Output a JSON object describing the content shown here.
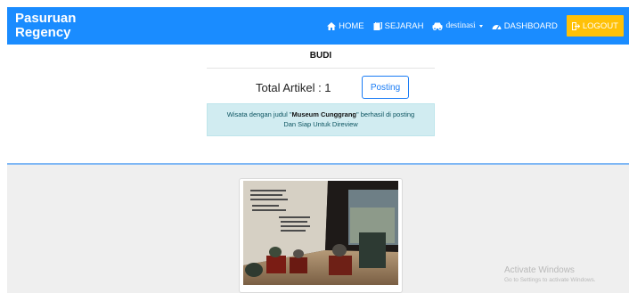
{
  "brand": {
    "name": "Pasuruan Regency"
  },
  "nav": {
    "home": "HOME",
    "sejarah": "SEJARAH",
    "destinasi": "destinasi",
    "dashboard": "DASHBOARD",
    "logout": "LOGOUT"
  },
  "profile": {
    "username": "BUDI"
  },
  "articles": {
    "total_text": "Total Artikel : 1",
    "posting_label": "Posting"
  },
  "alert": {
    "prefix": "Wisata dengan judul \"",
    "title": "Museum Cunggrang",
    "suffix": "\" berhasil di posting",
    "line2": "Dan Siap Untuk Direview"
  },
  "watermark": {
    "line1": "Activate Windows",
    "line2": "Go to Settings to activate Windows."
  },
  "colors": {
    "navbar": "#1a8cff",
    "logout": "#ffc107",
    "alert_bg": "#d1ecf1",
    "accent": "#1a7cf5"
  }
}
